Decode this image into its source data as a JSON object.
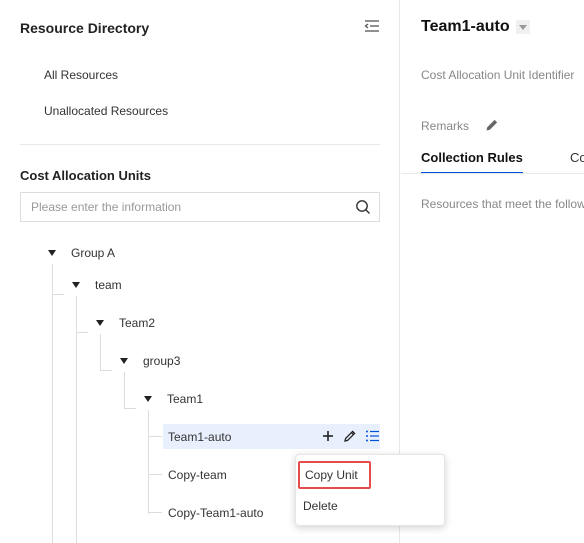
{
  "sidebar": {
    "title": "Resource Directory",
    "links": [
      "All Resources",
      "Unallocated Resources"
    ],
    "section_title": "Cost Allocation Units",
    "search_placeholder": "Please enter the information"
  },
  "tree": {
    "group_a": "Group A",
    "team": "team",
    "team2": "Team2",
    "group3": "group3",
    "team1": "Team1",
    "team1_auto": "Team1-auto",
    "copy_team": "Copy-team",
    "copy_team1_auto": "Copy-Team1-auto"
  },
  "context_menu": {
    "copy_unit": "Copy Unit",
    "delete": "Delete"
  },
  "detail": {
    "title": "Team1-auto",
    "identifier_label": "Cost Allocation Unit Identifier",
    "remarks_label": "Remarks",
    "tabs": [
      "Collection Rules",
      "Co"
    ],
    "rules_text": "Resources that meet the follow"
  },
  "colors": {
    "accent": "#0052d9",
    "selected_bg": "#e8effd",
    "highlight_border": "#e34d4d"
  }
}
